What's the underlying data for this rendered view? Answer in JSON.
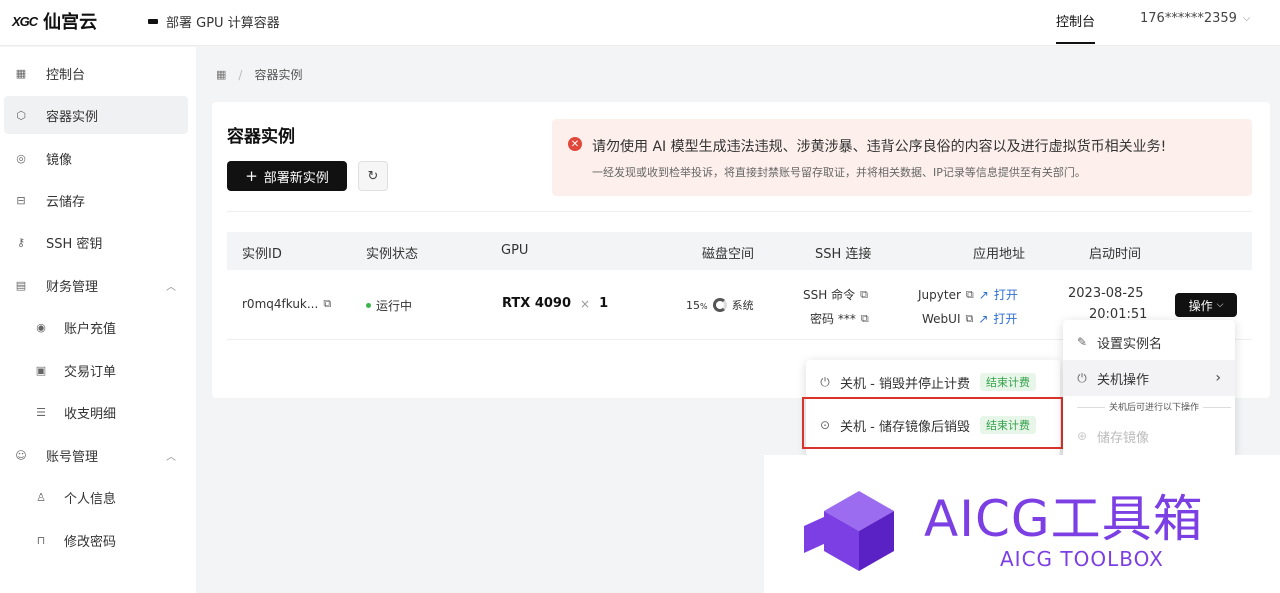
{
  "topbar": {
    "logo_mark": "XGC",
    "logo_text": "仙宫云",
    "deploy_label": "部署 GPU 计算容器",
    "console_label": "控制台",
    "user": "176******2359"
  },
  "sidebar": {
    "items": [
      {
        "label": "控制台",
        "icon": "grid-icon"
      },
      {
        "label": "容器实例",
        "icon": "cube-icon"
      },
      {
        "label": "镜像",
        "icon": "disc-icon"
      },
      {
        "label": "云储存",
        "icon": "storage-icon"
      },
      {
        "label": "SSH 密钥",
        "icon": "key-icon"
      },
      {
        "label": "财务管理",
        "icon": "wallet-icon"
      },
      {
        "label": "账户充值",
        "icon": "recharge-icon"
      },
      {
        "label": "交易订单",
        "icon": "order-icon"
      },
      {
        "label": "收支明细",
        "icon": "list-icon"
      },
      {
        "label": "账号管理",
        "icon": "account-icon"
      },
      {
        "label": "个人信息",
        "icon": "user-icon"
      },
      {
        "label": "修改密码",
        "icon": "lock-icon"
      }
    ]
  },
  "breadcrumb": {
    "current": "容器实例"
  },
  "main": {
    "title": "容器实例",
    "deploy_button": "部署新实例",
    "alert_title": "请勿使用 AI 模型生成违法违规、涉黄涉暴、违背公序良俗的内容以及进行虚拟货币相关业务!",
    "alert_sub": "一经发现或收到检举投诉，将直接封禁账号留存取证，并将相关数据、IP记录等信息提供至有关部门。"
  },
  "table": {
    "headers": [
      "实例ID",
      "实例状态",
      "GPU",
      "磁盘空间",
      "SSH 连接",
      "应用地址",
      "启动时间"
    ],
    "row": {
      "id": "r0mq4fkuk...",
      "status": "运行中",
      "gpu": "RTX 4090",
      "gpu_count": "1",
      "disk_percent": "15",
      "disk_unit": "%",
      "disk_label": "系统",
      "ssh_cmd": "SSH 命令",
      "ssh_pwd": "密码 ***",
      "app1": "Jupyter",
      "app2": "WebUI",
      "open": "打开",
      "start_date": "2023-08-25",
      "start_time": "20:01:51",
      "op_button": "操作"
    }
  },
  "menu_right": {
    "set_name": "设置实例名",
    "shutdown_ops": "关机操作",
    "note": "关机后可进行以下操作",
    "save_image": "储存镜像"
  },
  "menu_left": {
    "item1": "关机 - 销毁并停止计费",
    "item2": "关机 - 储存镜像后销毁",
    "tag": "结束计费"
  },
  "watermark": {
    "title": "AICG工具箱",
    "subtitle": "AICG TOOLBOX"
  }
}
